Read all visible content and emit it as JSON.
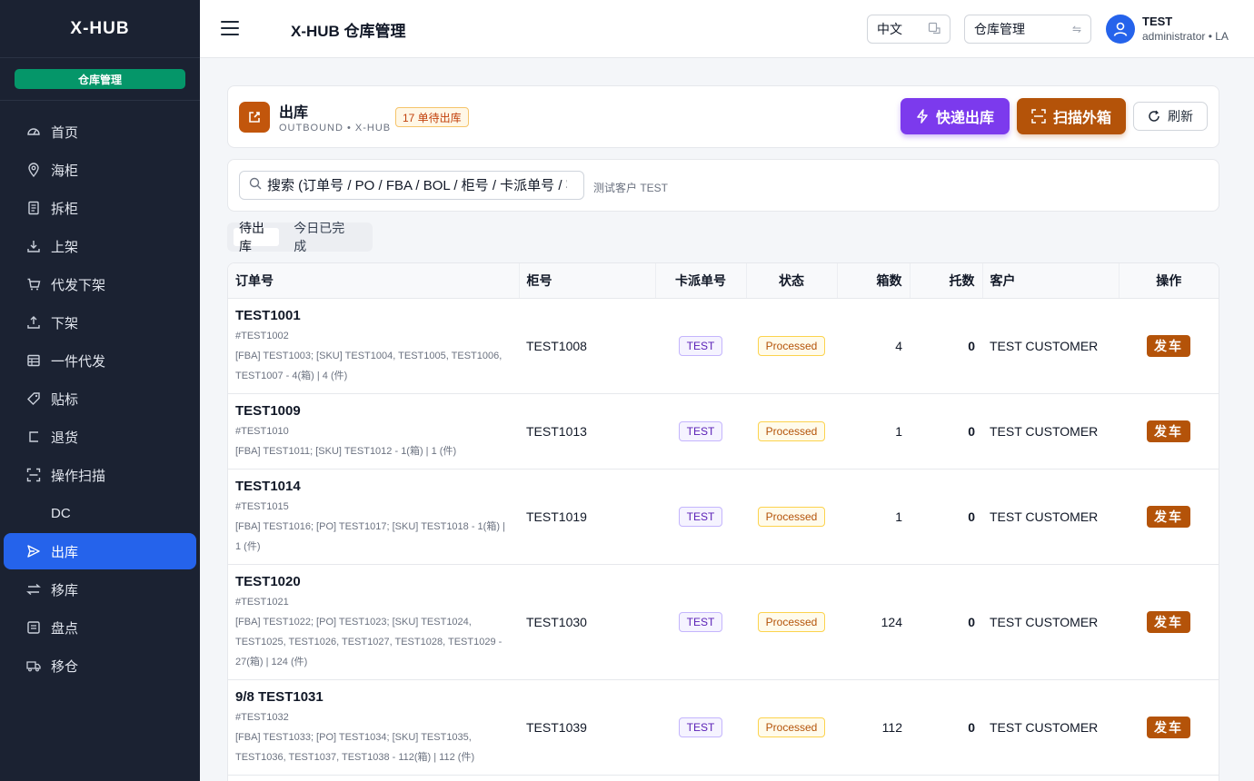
{
  "sidebar": {
    "brand": "X-HUB",
    "warehouse_badge": "仓库管理",
    "items": [
      {
        "label": "首页",
        "icon": "dashboard-icon"
      },
      {
        "label": "海柜",
        "icon": "location-pin-icon"
      },
      {
        "label": "拆柜",
        "icon": "document-icon"
      },
      {
        "label": "上架",
        "icon": "download-tray-icon"
      },
      {
        "label": "代发下架",
        "icon": "cart-icon"
      },
      {
        "label": "下架",
        "icon": "upload-tray-icon"
      },
      {
        "label": "一件代发",
        "icon": "calendar-grid-icon"
      },
      {
        "label": "贴标",
        "icon": "tag-icon"
      },
      {
        "label": "退货",
        "icon": "return-icon"
      },
      {
        "label": "操作扫描",
        "icon": "scan-icon"
      },
      {
        "label": "DC",
        "icon": "dc-icon"
      },
      {
        "label": "出库",
        "icon": "send-icon",
        "active": true
      },
      {
        "label": "移库",
        "icon": "swap-icon"
      },
      {
        "label": "盘点",
        "icon": "inventory-icon"
      },
      {
        "label": "移仓",
        "icon": "truck-icon"
      }
    ]
  },
  "topbar": {
    "title": "X-HUB 仓库管理",
    "language": "中文",
    "module": "仓库管理",
    "user_name": "TEST",
    "user_role": "administrator",
    "user_region": "LA"
  },
  "header": {
    "title": "出库",
    "subtitle": "OUTBOUND • X-HUB",
    "pending_badge": "17 单待出库",
    "express_button": "快递出库",
    "scan_button": "扫描外箱",
    "refresh_button": "刷新",
    "accent": "#c2560c"
  },
  "search": {
    "placeholder": "搜索 (订单号 / PO / FBA / BOL / 柜号 / 卡派单号 / 客户",
    "customer_note": "测试客户 TEST"
  },
  "tabs": [
    {
      "label": "待出库",
      "active": true
    },
    {
      "label": "今日已完成",
      "active": false
    }
  ],
  "table": {
    "headers": [
      "订单号",
      "柜号",
      "卡派单号",
      "状态",
      "箱数",
      "托数",
      "客户",
      "操作"
    ],
    "rows": [
      {
        "order": "TEST1001",
        "ref": "#TEST1002",
        "detail": "[FBA] TEST1003; [SKU] TEST1004, TEST1005, TEST1006, TEST1007 - 4(箱) | 4 (件)",
        "container": "TEST1008",
        "truck": "TEST",
        "status": "Processed",
        "boxes": "4",
        "pallets": "0",
        "customer": "TEST CUSTOMER",
        "action": "发车"
      },
      {
        "order": "TEST1009",
        "ref": "#TEST1010",
        "detail": "[FBA] TEST1011; [SKU] TEST1012 - 1(箱) | 1 (件)",
        "container": "TEST1013",
        "truck": "TEST",
        "status": "Processed",
        "boxes": "1",
        "pallets": "0",
        "customer": "TEST CUSTOMER",
        "action": "发车"
      },
      {
        "order": "TEST1014",
        "ref": "#TEST1015",
        "detail": "[FBA] TEST1016; [PO] TEST1017; [SKU] TEST1018 - 1(箱) | 1 (件)",
        "container": "TEST1019",
        "truck": "TEST",
        "status": "Processed",
        "boxes": "1",
        "pallets": "0",
        "customer": "TEST CUSTOMER",
        "action": "发车"
      },
      {
        "order": "TEST1020",
        "ref": "#TEST1021",
        "detail": "[FBA] TEST1022; [PO] TEST1023; [SKU] TEST1024, TEST1025, TEST1026, TEST1027, TEST1028, TEST1029 - 27(箱) | 124 (件)",
        "container": "TEST1030",
        "truck": "TEST",
        "status": "Processed",
        "boxes": "124",
        "pallets": "0",
        "customer": "TEST CUSTOMER",
        "action": "发车"
      },
      {
        "order": "9/8 TEST1031",
        "ref": "#TEST1032",
        "detail": "[FBA] TEST1033; [PO] TEST1034; [SKU] TEST1035, TEST1036, TEST1037, TEST1038 - 112(箱) | 112 (件)",
        "container": "TEST1039",
        "truck": "TEST",
        "status": "Processed",
        "boxes": "112",
        "pallets": "0",
        "customer": "TEST CUSTOMER",
        "action": "发车"
      }
    ]
  }
}
